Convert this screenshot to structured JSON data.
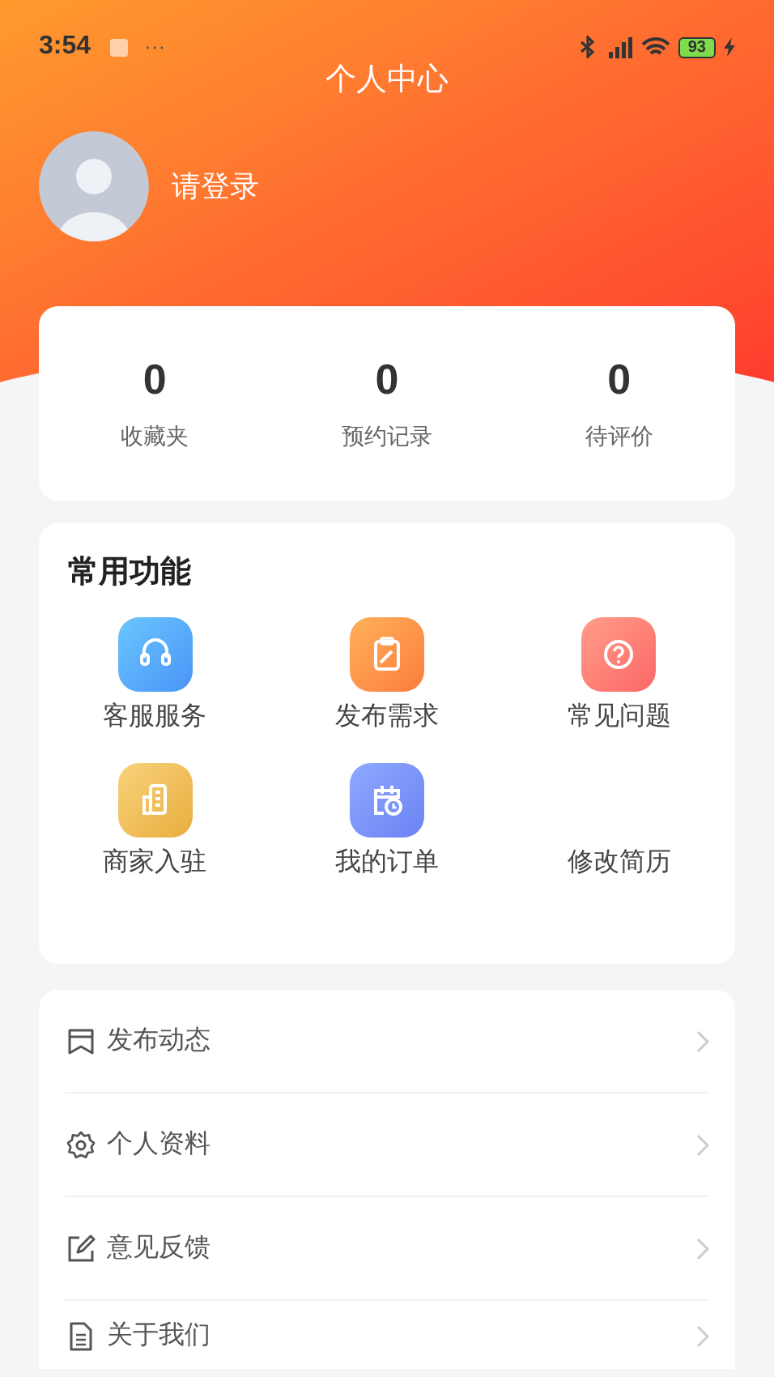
{
  "status_bar": {
    "time": "3:54",
    "more": "···",
    "battery": "93"
  },
  "header": {
    "title": "个人中心",
    "login_text": "请登录"
  },
  "stats": [
    {
      "value": "0",
      "label": "收藏夹"
    },
    {
      "value": "0",
      "label": "预约记录"
    },
    {
      "value": "0",
      "label": "待评价"
    }
  ],
  "functions": {
    "title": "常用功能",
    "items": [
      {
        "label": "客服服务",
        "kind": "headset"
      },
      {
        "label": "发布需求",
        "kind": "clipboard"
      },
      {
        "label": "常见问题",
        "kind": "question"
      },
      {
        "label": "商家入驻",
        "kind": "building"
      },
      {
        "label": "我的订单",
        "kind": "calendar"
      },
      {
        "label": "修改简历"
      }
    ]
  },
  "menu": [
    {
      "label": "发布动态",
      "kind": "bookmark"
    },
    {
      "label": "个人资料",
      "kind": "gear"
    },
    {
      "label": "意见反馈",
      "kind": "edit"
    },
    {
      "label": "关于我们",
      "kind": "document"
    }
  ]
}
